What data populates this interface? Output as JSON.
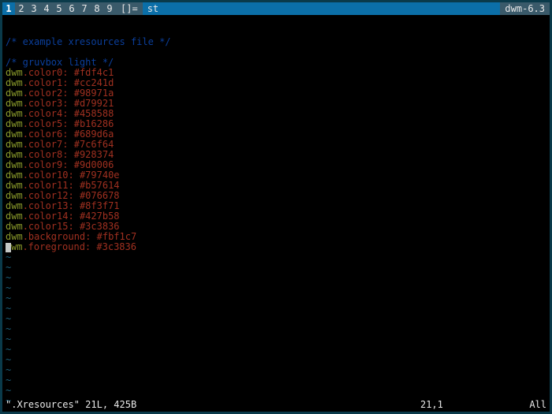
{
  "bar": {
    "tags": [
      "1",
      "2",
      "3",
      "4",
      "5",
      "6",
      "7",
      "8",
      "9"
    ],
    "selected": 0,
    "layout": "[]=",
    "title": "st",
    "status": "dwm-6.3"
  },
  "file": {
    "comment1": "/* example xresources file */",
    "comment2": "/* gruvbox light */",
    "lines": [
      {
        "key": "dwm",
        "prop": ".color0:",
        "val": "#fdf4c1"
      },
      {
        "key": "dwm",
        "prop": ".color1:",
        "val": "#cc241d"
      },
      {
        "key": "dwm",
        "prop": ".color2:",
        "val": "#98971a"
      },
      {
        "key": "dwm",
        "prop": ".color3:",
        "val": "#d79921"
      },
      {
        "key": "dwm",
        "prop": ".color4:",
        "val": "#458588"
      },
      {
        "key": "dwm",
        "prop": ".color5:",
        "val": "#b16286"
      },
      {
        "key": "dwm",
        "prop": ".color6:",
        "val": "#689d6a"
      },
      {
        "key": "dwm",
        "prop": ".color7:",
        "val": "#7c6f64"
      },
      {
        "key": "dwm",
        "prop": ".color8:",
        "val": "#928374"
      },
      {
        "key": "dwm",
        "prop": ".color9:",
        "val": "#9d0006"
      },
      {
        "key": "dwm",
        "prop": ".color10:",
        "val": "#79740e"
      },
      {
        "key": "dwm",
        "prop": ".color11:",
        "val": "#b57614"
      },
      {
        "key": "dwm",
        "prop": ".color12:",
        "val": "#076678"
      },
      {
        "key": "dwm",
        "prop": ".color13:",
        "val": "#8f3f71"
      },
      {
        "key": "dwm",
        "prop": ".color14:",
        "val": "#427b58"
      },
      {
        "key": "dwm",
        "prop": ".color15:",
        "val": "#3c3836"
      },
      {
        "key": "dwm",
        "prop": ".background:",
        "val": "#fbf1c7"
      },
      {
        "key": "dwm",
        "prop": ".foreground:",
        "val": "#3c3836"
      }
    ],
    "tilde_count": 15
  },
  "vim": {
    "fname": "\".Xresources\" 21L, 425B",
    "pos": "21,1",
    "pct": "All"
  }
}
